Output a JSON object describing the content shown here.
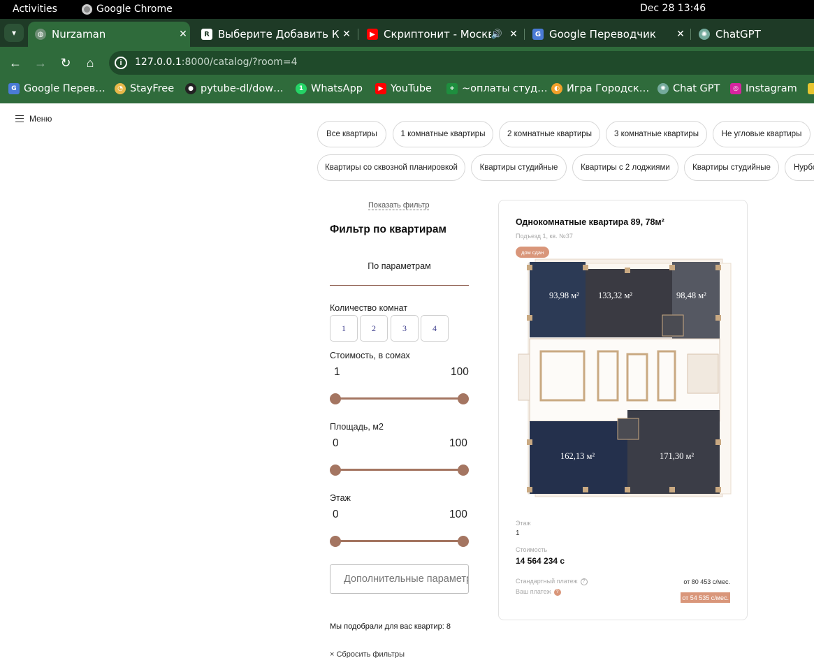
{
  "system": {
    "activities": "Activities",
    "app_name": "Google Chrome",
    "clock": "Dec 28  13:46"
  },
  "tabs": [
    {
      "title": "Nurzaman",
      "active": true,
      "icon": "globe-icon"
    },
    {
      "title": "Выберите Добавить Ко",
      "active": false,
      "icon": "bank-icon"
    },
    {
      "title": "Скриптонит - Москва",
      "active": false,
      "icon": "youtube-icon"
    },
    {
      "title": "Google Переводчик",
      "active": false,
      "icon": "translate-icon"
    },
    {
      "title": "ChatGPT",
      "active": false,
      "icon": "chatgpt-icon"
    }
  ],
  "address": {
    "host": "127.0.0.1",
    "rest": ":8000/catalog/?room=4"
  },
  "bookmarks": [
    {
      "label": "Google Перев…",
      "icon": "translate-icon",
      "color": "#4a7bd6"
    },
    {
      "label": "StayFree",
      "icon": "stayfree-icon",
      "color": "#e8b84a"
    },
    {
      "label": "pytube-dl/dow…",
      "icon": "github-icon",
      "color": "#222222"
    },
    {
      "label": "WhatsApp",
      "icon": "whatsapp-icon",
      "color": "#25d366"
    },
    {
      "label": "YouTube",
      "icon": "youtube-icon",
      "color": "#ff0000"
    },
    {
      "label": "~оплаты студ…",
      "icon": "sheets-icon",
      "color": "#1e8e3e"
    },
    {
      "label": "Игра Городск…",
      "icon": "game-icon",
      "color": "#f2a12b"
    },
    {
      "label": "Chat GPT",
      "icon": "chatgpt-icon",
      "color": "#74aa9c"
    },
    {
      "label": "Instagram",
      "icon": "instagram-icon",
      "color": "#d6249f"
    }
  ],
  "page": {
    "menu_label": "Меню",
    "chips_row1": [
      "Все квартиры",
      "1 комнатные квартиры",
      "2 комнатные квартиры",
      "3 комнатные квартиры",
      "Не угловые квартиры"
    ],
    "chips_row2": [
      "Квартиры со сквозной планировкой",
      "Квартиры студийные",
      "Квартиры с 2 лоджиями",
      "Квартиры студийные",
      "Нурбол"
    ],
    "show_filter": "Показать фильтр",
    "filter_title": "Фильтр по квартирам",
    "params_tab": "По параметрам",
    "rooms_label": "Количество комнат",
    "rooms": [
      "1",
      "2",
      "3",
      "4"
    ],
    "price_label": "Стоимость, в сомах",
    "price_min": "1",
    "price_max": "100",
    "area_label": "Площадь, м2",
    "area_min": "0",
    "area_max": "100",
    "floor_label": "Этаж",
    "floor_min": "0",
    "floor_max": "100",
    "more_params": "Дополнительные параметры",
    "found_text": "Мы подобрали для вас квартир: 8",
    "reset_text": "× Сбросить фильтры"
  },
  "card": {
    "title": "Однокомнатные квартира 89, 78м²",
    "subtitle": "Подъезд 1, кв. №37",
    "badge": "дом сдан",
    "plan_areas": [
      "93,98 м²",
      "133,32 м²",
      "98,48 м²",
      "162,13 м²",
      "171,30 м²"
    ],
    "floor_label": "Этаж",
    "floor_value": "1",
    "price_label": "Стоимость",
    "price_value": "14 564 234 с",
    "std_payment_label": "Стандартный платеж",
    "std_payment_value": "от 80 453 с/мес.",
    "your_payment_label": "Ваш платеж",
    "your_payment_value": "от 54 535 с/мес."
  },
  "colors": {
    "chrome_tabstrip": "#1e3a26",
    "chrome_toolbar": "#2f6b3b",
    "accent": "#a47561",
    "badge": "#d9967a"
  }
}
